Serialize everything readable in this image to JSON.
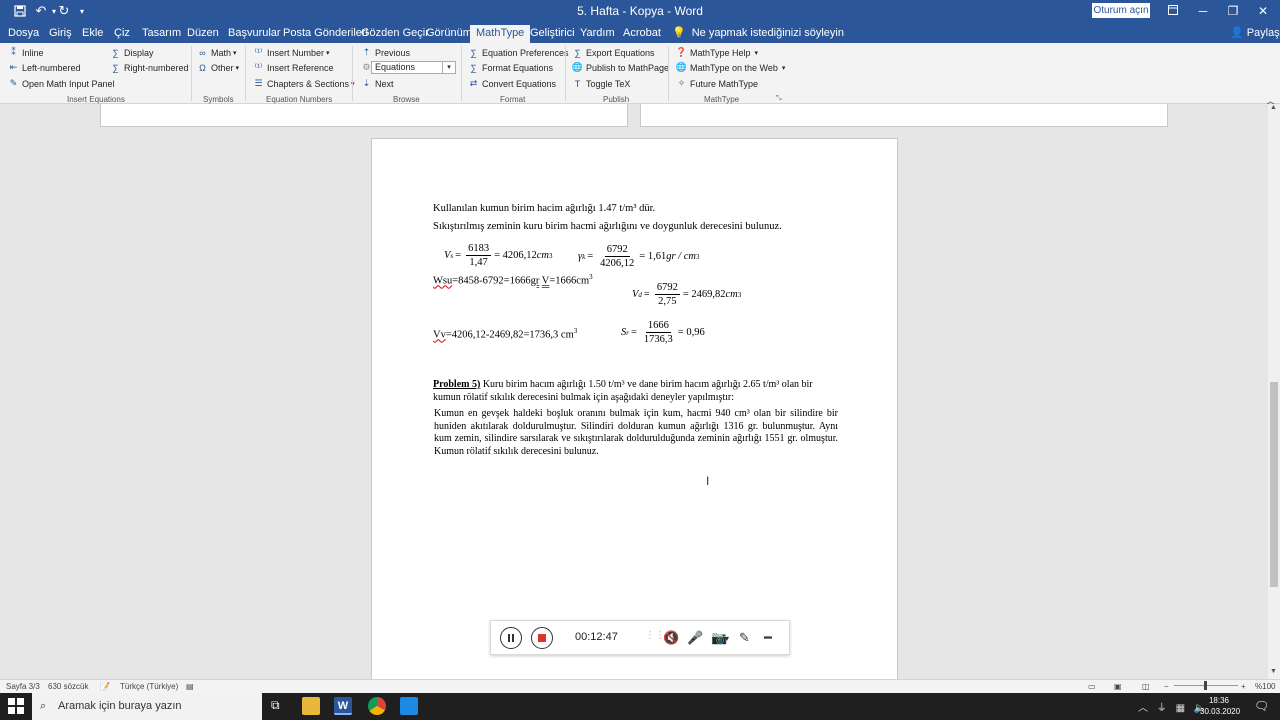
{
  "window": {
    "title": "5. Hafta - Kopya  -  Word",
    "sign_in": "Oturum açın",
    "share": "Paylaş"
  },
  "tabs": [
    "Dosya",
    "Giriş",
    "Ekle",
    "Çiz",
    "Tasarım",
    "Düzen",
    "Başvurular",
    "Posta Gönderileri",
    "Gözden Geçir",
    "Görünüm",
    "MathType",
    "Geliştirici",
    "Yardım",
    "Acrobat"
  ],
  "active_tab": "MathType",
  "tell_me": "Ne yapmak istediğinizi söyleyin",
  "ribbon": {
    "insert_equations": {
      "label": "Insert Equations",
      "inline": "Inline",
      "display": "Display",
      "left_numbered": "Left-numbered",
      "right_numbered": "Right-numbered",
      "open_math_input": "Open Math Input Panel"
    },
    "symbols": {
      "label": "Symbols",
      "math": "Math",
      "other": "Other"
    },
    "equation_numbers": {
      "label": "Equation Numbers",
      "insert_number": "Insert Number",
      "insert_reference": "Insert Reference",
      "chapters_sections": "Chapters & Sections"
    },
    "browse": {
      "label": "Browse",
      "previous": "Previous",
      "selector": "Equations",
      "next": "Next"
    },
    "format": {
      "label": "Format",
      "equation_preferences": "Equation Preferences",
      "format_equations": "Format Equations",
      "convert_equations": "Convert Equations"
    },
    "publish": {
      "label": "Publish",
      "export_equations": "Export Equations",
      "publish_mathpage": "Publish to MathPage",
      "toggle_tex": "Toggle TeX"
    },
    "mathtype": {
      "label": "MathType",
      "help": "MathType Help",
      "on_web": "MathType on the Web",
      "future": "Future MathType"
    }
  },
  "document": {
    "line1": "Kullanılan kumun birim hacim ağırlığı 1.47 t/m³ dür.",
    "line2": "Sıkıştırılmış zeminin kuru birim hacmi ağırlığını ve doygunluk derecesini bulunuz.",
    "eq_vs": {
      "lhs": "V",
      "sub": "s",
      "num": "6183",
      "den": "1,47",
      "rhs": "= 4206,12",
      "unit": "cm",
      "sup": "3"
    },
    "eq_gk": {
      "lhs": "γ",
      "sub": "k",
      "num": "6792",
      "den": "4206,12",
      "rhs": "= 1,61",
      "unit": "gr / cm",
      "sup": "3"
    },
    "wsu_prefix": "Wsu",
    "wsu_mid": "=8458-6792=1666",
    "wsu_gr": "gr",
    "wsu_v": "V",
    "wsu_rest": "=1666cm",
    "wsu_sup": "3",
    "eq_vd": {
      "lhs": "V",
      "sub": "d",
      "num": "6792",
      "den": "2,75",
      "rhs": "= 2469,82",
      "unit": "cm",
      "sup": "3"
    },
    "vv_prefix": "Vv",
    "vv_rest": "=4206,12-2469,82=1736,3 cm",
    "vv_sup": "3",
    "eq_sr": {
      "lhs": "S",
      "sub": "r",
      "num": "1666",
      "den": "1736,3",
      "rhs": "= 0,96"
    },
    "problem_label": "Problem 5)",
    "problem_text_1": " Kuru birim hacım ağırlığı 1.50 t/m³ ve dane birim hacım ağırlığı 2.65 t/m³ olan bir",
    "problem_text_2": "kumun rölatif sıkılık derecesini bulmak için aşağıdaki deneyler yapılmıştır:",
    "para": "Kumun en gevşek haldeki boşluk oranını bulmak için kum, hacmi 940 cm³ olan bir silindire bir huniden akıtılarak doldurulmuştur. Silindiri dolduran kumun ağırlığı 1316 gr. bulunmuştur. Aynı kum zemin, silindire sarsılarak ve sıkıştırılarak doldurulduğunda zeminin ağırlığı 1551 gr. olmuştur. Kumun rölatif sıkılık derecesini bulunuz."
  },
  "recorder": {
    "time": "00:12:47"
  },
  "status": {
    "page": "Sayfa 3/3",
    "words": "630 sözcük",
    "language": "Türkçe (Türkiye)",
    "zoom": "%100"
  },
  "taskbar": {
    "search_placeholder": "Aramak için buraya yazın",
    "time": "18:36",
    "date": "30.03.2020"
  },
  "colors": {
    "word_blue": "#2b579a",
    "ribbon_bg": "#f3f3f3",
    "recorder_red": "#e0312f"
  }
}
